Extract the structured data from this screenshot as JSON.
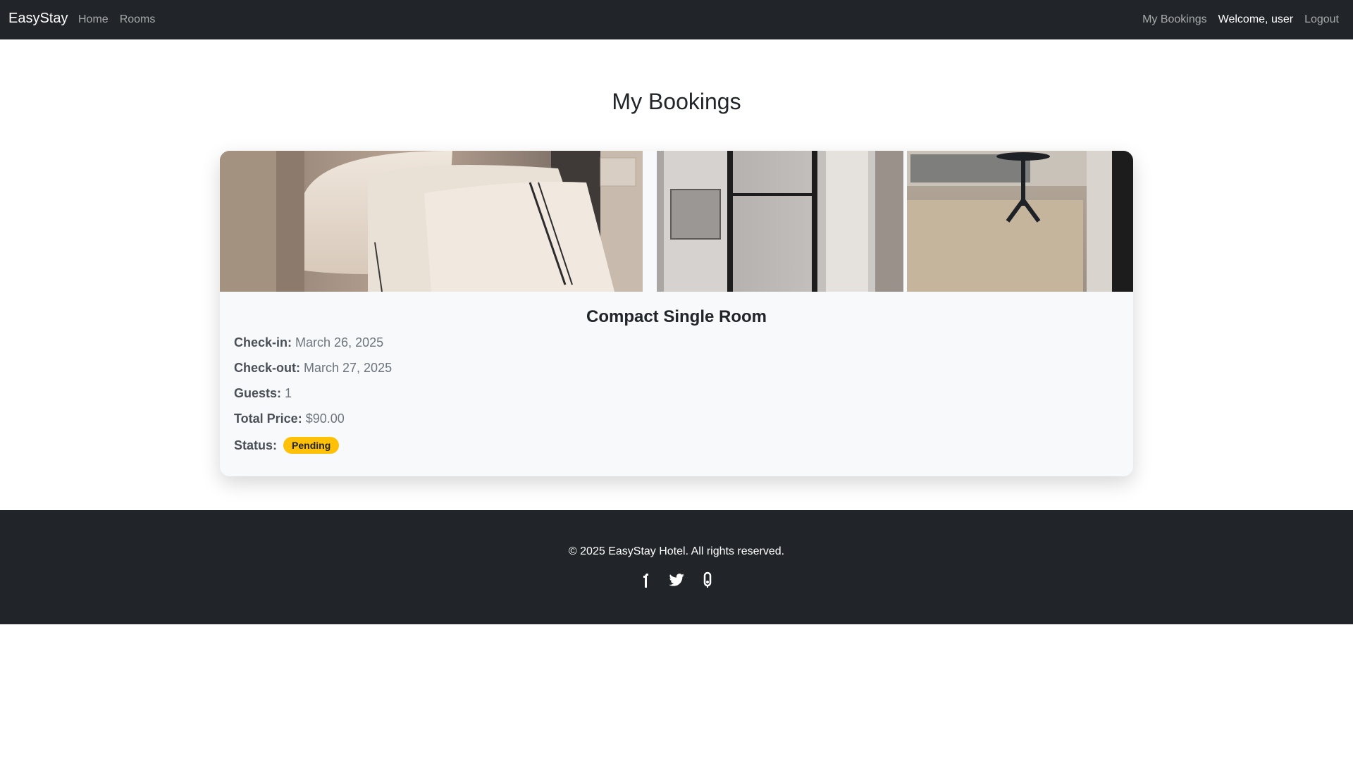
{
  "nav": {
    "brand": "EasyStay",
    "links_left": [
      "Home",
      "Rooms"
    ],
    "my_bookings": "My Bookings",
    "welcome": "Welcome, user",
    "logout": "Logout"
  },
  "page": {
    "title": "My Bookings"
  },
  "booking": {
    "room_name": "Compact Single Room",
    "checkin_label": "Check-in:",
    "checkin_value": "March 26, 2025",
    "checkout_label": "Check-out:",
    "checkout_value": "March 27, 2025",
    "guests_label": "Guests:",
    "guests_value": "1",
    "price_label": "Total Price:",
    "price_value": "$90.00",
    "status_label": "Status:",
    "status_value": "Pending"
  },
  "footer": {
    "copyright": "© 2025 EasyStay Hotel. All rights reserved.",
    "social_icons": [
      "facebook-icon",
      "twitter-icon",
      "instagram-icon"
    ]
  },
  "colors": {
    "navbar_bg": "#212529",
    "badge_warning": "#ffc107",
    "card_bg": "#f8f9fa"
  }
}
